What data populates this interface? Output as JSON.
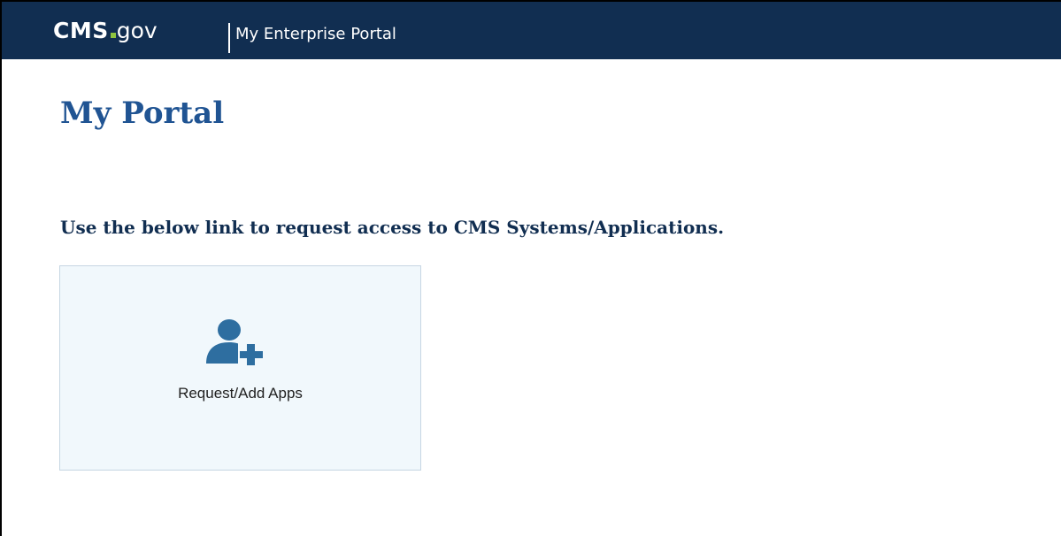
{
  "header": {
    "logo_cms": "CMS",
    "logo_gov": "gov",
    "portal_name": "My Enterprise Portal",
    "background_color": "#112e51",
    "logo_dot_color": "#8fc43f"
  },
  "main": {
    "title": "My Portal",
    "instructions": "Use the below link to request access to CMS Systems/Applications.",
    "tiles": [
      {
        "label": "Request/Add Apps",
        "icon": "user-add-icon",
        "icon_color": "#2e6ea0"
      }
    ]
  },
  "colors": {
    "title": "#205493",
    "instructions": "#112e51",
    "tile_background": "#f1f8fc",
    "tile_border": "#c6d6e3"
  }
}
